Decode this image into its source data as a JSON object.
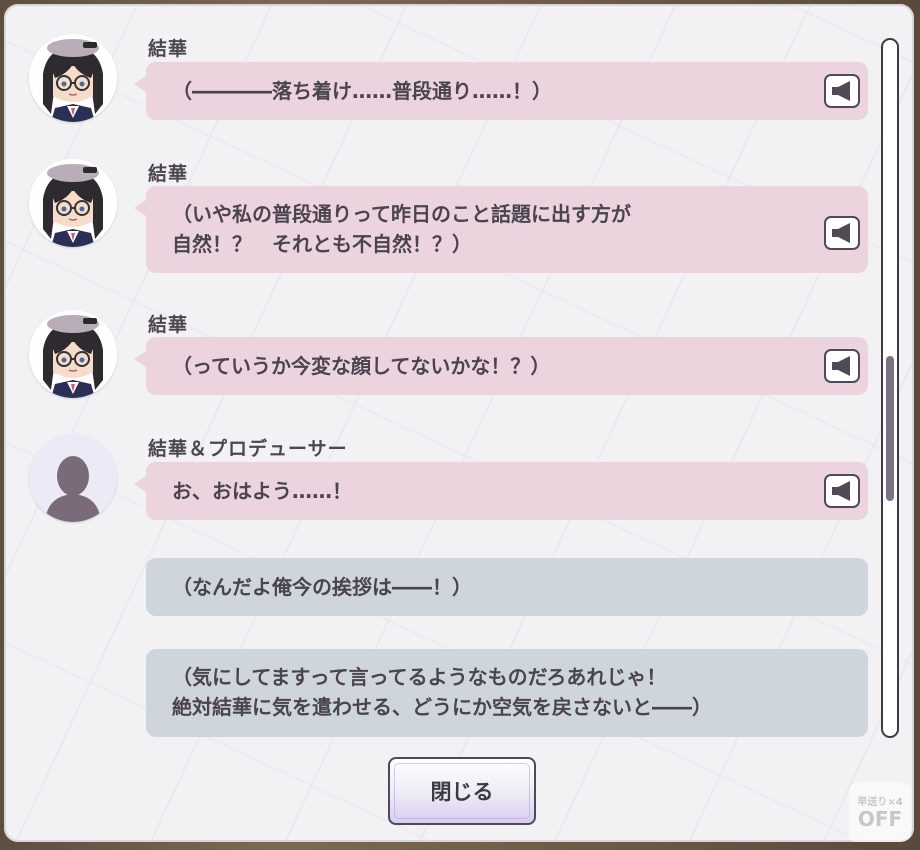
{
  "log": {
    "entries": [
      {
        "speaker": "結華",
        "lines": [
          "（――――落ち着け……普段通り……！）"
        ],
        "voice": true,
        "type": "character"
      },
      {
        "speaker": "結華",
        "lines": [
          "（いや私の普段通りって昨日のこと話題に出す方が",
          "自然！？　それとも不自然！？）"
        ],
        "voice": true,
        "type": "character"
      },
      {
        "speaker": "結華",
        "lines": [
          "（っていうか今変な顔してないかな！？）"
        ],
        "voice": true,
        "type": "character"
      },
      {
        "speaker": "結華＆プロデューサー",
        "lines": [
          "お、おはよう……！"
        ],
        "voice": true,
        "type": "silhouette"
      },
      {
        "speaker": "",
        "lines": [
          "（なんだよ俺今の挨拶は――！）"
        ],
        "voice": false,
        "type": "narration"
      },
      {
        "speaker": "",
        "lines": [
          "（気にしてますって言ってるようなものだろあれじゃ！",
          "絶対結華に気を遣わせる、どうにか空気を戻さないと――）"
        ],
        "voice": false,
        "type": "narration"
      }
    ]
  },
  "buttons": {
    "close_label": "閉じる"
  },
  "auto_badge": {
    "line1": "早送り×4",
    "line2": "OFF"
  },
  "scrollbar": {
    "position_fraction": 0.45
  },
  "colors": {
    "character_bubble": "#ecd4de",
    "narration_bubble": "#cfd5dc",
    "text": "#4a4350"
  },
  "icons": {
    "voice": "speaker-icon",
    "avatar_placeholder": "silhouette-icon"
  }
}
